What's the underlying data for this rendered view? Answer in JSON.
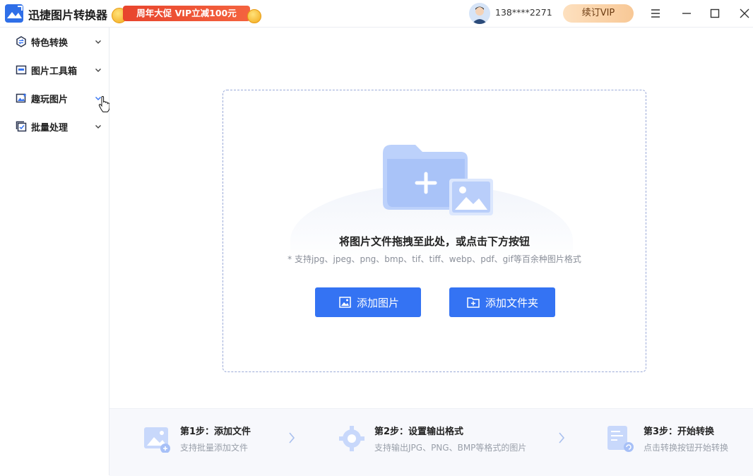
{
  "app": {
    "name": "迅捷图片转换器"
  },
  "promo": {
    "text": "周年大促 VIP立减100元"
  },
  "user": {
    "name": "138****2271",
    "vip_button": "续订VIP"
  },
  "sidebar": {
    "items": [
      {
        "label": "特色转换",
        "icon": "convert-icon"
      },
      {
        "label": "图片工具箱",
        "icon": "toolbox-icon"
      },
      {
        "label": "趣玩图片",
        "icon": "fun-image-icon"
      },
      {
        "label": "批量处理",
        "icon": "batch-icon"
      }
    ]
  },
  "dropzone": {
    "title": "将图片文件拖拽至此处，或点击下方按钮",
    "subtitle": "* 支持jpg、jpeg、png、bmp、tif、tiff、webp、pdf、gif等百余种图片格式",
    "add_image": "添加图片",
    "add_folder": "添加文件夹"
  },
  "steps": [
    {
      "title": "第1步：添加文件",
      "desc": "支持批量添加文件"
    },
    {
      "title": "第2步：设置输出格式",
      "desc": "支持输出JPG、PNG、BMP等格式的图片"
    },
    {
      "title": "第3步：开始转换",
      "desc": "点击转换按钮开始转换"
    }
  ],
  "colors": {
    "primary": "#3473f3",
    "promo": "#e8452d",
    "vip": "#f8c896"
  }
}
